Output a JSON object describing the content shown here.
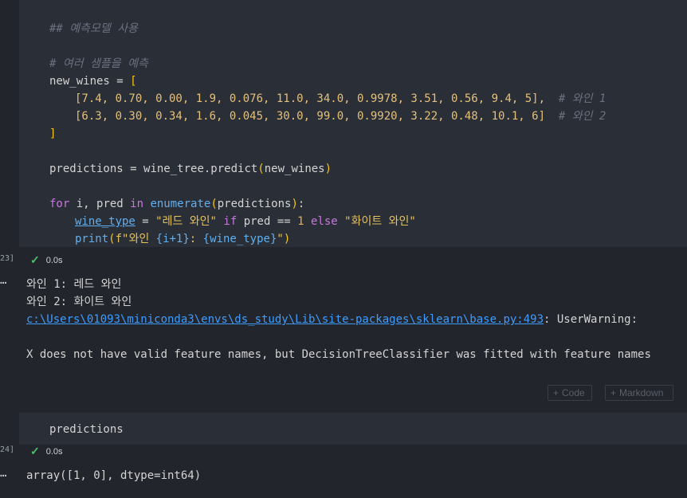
{
  "cell1": {
    "exec_count": "23]",
    "status_time": "0.0s",
    "lines": {
      "comment_title": "## 예측모델 사용",
      "comment_sub": "# 여러 샘플을 예측",
      "new_wines_var": "new_wines",
      "assign": " = ",
      "open_bracket": "[",
      "row1": "[7.4, 0.70, 0.00, 1.9, 0.076, 11.0, 34.0, 0.9978, 3.51, 0.56, 9.4, 5],",
      "row1_comment": "# 와인 1",
      "row2": "[6.3, 0.30, 0.34, 1.6, 0.045, 30.0, 99.0, 0.9920, 3.22, 0.48, 10.1, 6]",
      "row2_comment": "# 와인 2",
      "close_bracket": "]",
      "pred_var": "predictions",
      "pred_obj": "wine_tree.predict",
      "pred_arg": "new_wines",
      "for_kw": "for",
      "for_vars": " i, pred ",
      "in_kw": "in",
      "enumerate_fn": "enumerate",
      "enum_arg": "predictions",
      "wine_type_var": "wine_type",
      "str_red": "\"레드 와인\"",
      "if_kw": "if",
      "cond": " pred == ",
      "one": "1",
      "else_kw": "else",
      "str_white": "\"화이트 와인\"",
      "print_fn": "print",
      "fstr_start": "f\"와인 ",
      "fstr_expr1": "{i+1}",
      "fstr_mid": ": ",
      "fstr_expr2": "{wine_type}",
      "fstr_end": "\""
    }
  },
  "output1": {
    "line1": "와인 1: 레드 와인",
    "line2": "와인 2: 화이트 와인",
    "warning_path": "c:\\Users\\01093\\miniconda3\\envs\\ds_study\\Lib\\site-packages\\sklearn\\base.py:493",
    "warning_type": ": UserWarning:",
    "warning_msg": "X does not have valid feature names, but DecisionTreeClassifier was fitted with feature names"
  },
  "add_buttons": {
    "code_label": "Code",
    "markdown_label": "Markdown"
  },
  "cell2": {
    "exec_count": "24]",
    "status_time": "0.0s",
    "code": "predictions"
  },
  "output2": {
    "result": "array([1, 0], dtype=int64)"
  },
  "icons": {
    "check": "check-icon",
    "more": "more-icon",
    "plus": "plus-icon"
  },
  "colors": {
    "success": "#4fc16a",
    "link": "#3e9cff",
    "keyword": "#c678dd",
    "function": "#61afef",
    "number": "#e3b34d"
  }
}
